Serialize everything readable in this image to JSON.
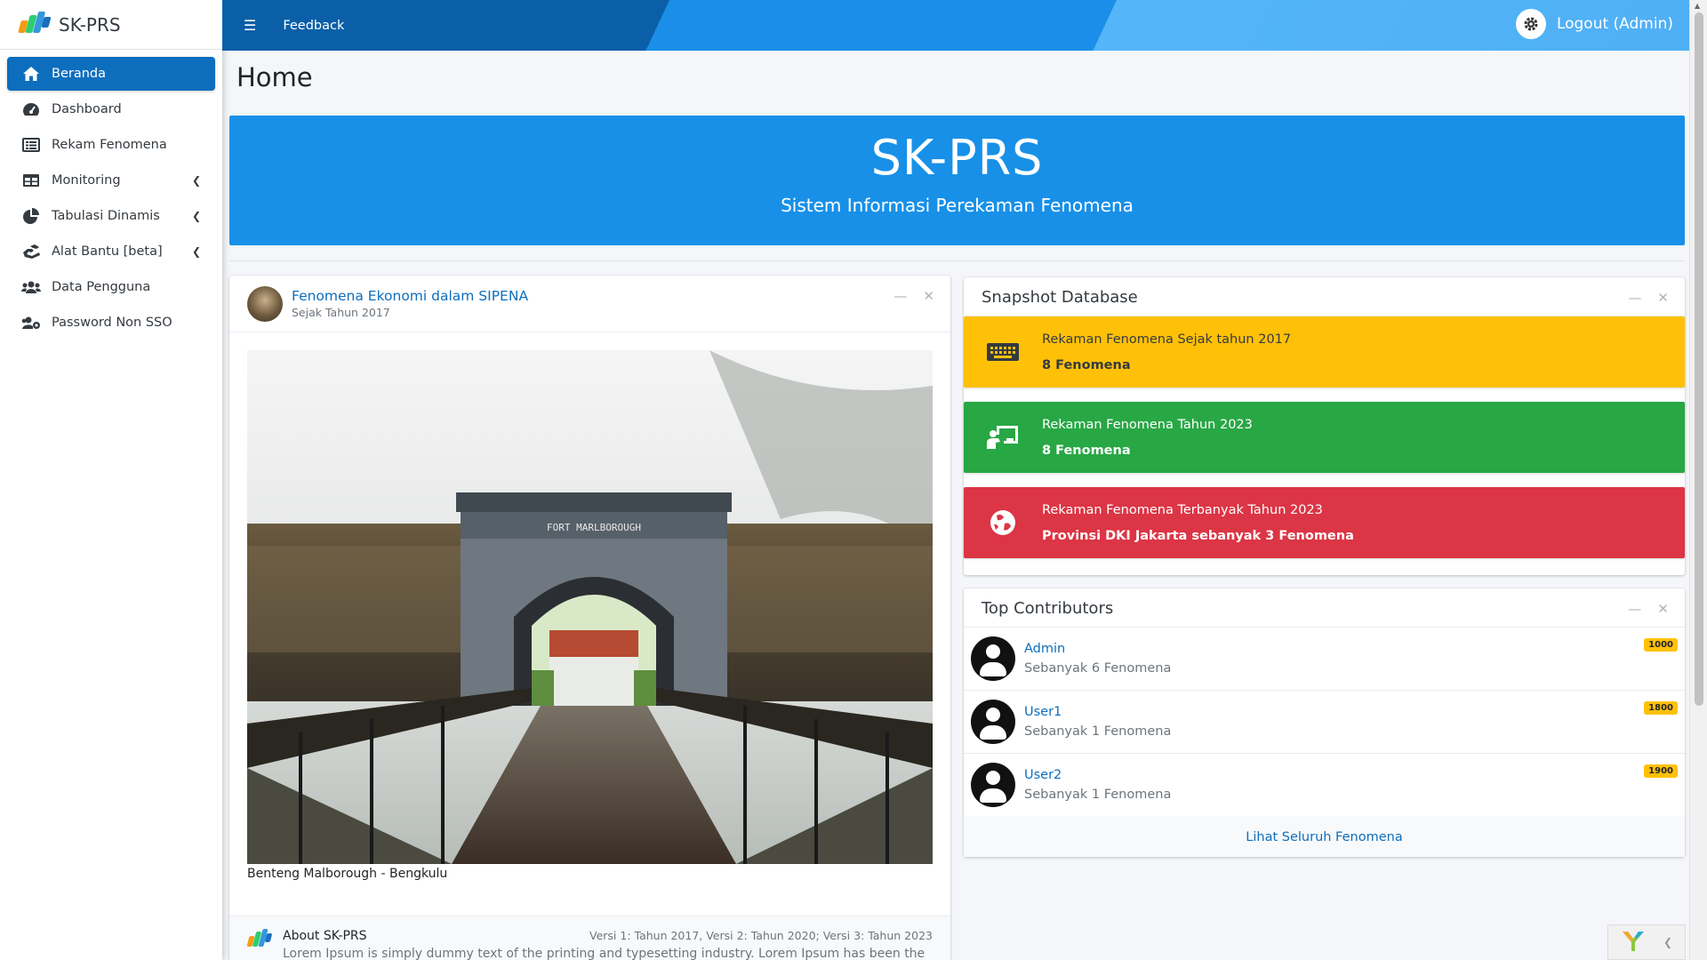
{
  "brand": {
    "name": "SK-PRS"
  },
  "sidebar": {
    "items": [
      {
        "label": "Beranda",
        "icon": "home-icon",
        "active": true
      },
      {
        "label": "Dashboard",
        "icon": "tachometer-icon"
      },
      {
        "label": "Rekam Fenomena",
        "icon": "list-alt-icon"
      },
      {
        "label": "Monitoring",
        "icon": "table-icon",
        "expandable": true
      },
      {
        "label": "Tabulasi Dinamis",
        "icon": "pie-chart-icon",
        "expandable": true
      },
      {
        "label": "Alat Bantu [beta]",
        "icon": "hands-helping-icon",
        "expandable": true
      },
      {
        "label": "Data Pengguna",
        "icon": "users-icon"
      },
      {
        "label": "Password Non SSO",
        "icon": "users-cog-icon"
      }
    ]
  },
  "topbar": {
    "feedback": "Feedback",
    "logout": "Logout (Admin)"
  },
  "page": {
    "title": "Home"
  },
  "hero": {
    "title": "SK-PRS",
    "subtitle": "Sistem Informasi Perekaman Fenomena"
  },
  "post": {
    "title": "Fenomena Ekonomi dalam SIPENA",
    "subtitle": "Sejak Tahun 2017",
    "image_text": "FORT MARLBOROUGH",
    "caption": "Benteng Malborough - Bengkulu",
    "about_title": "About SK-PRS",
    "about_version": "Versi 1: Tahun 2017, Versi 2: Tahun 2020; Versi 3: Tahun 2023",
    "about_text": "Lorem Ipsum is simply dummy text of the printing and typesetting industry. Lorem Ipsum has been the"
  },
  "snapshot": {
    "title": "Snapshot Database",
    "boxes": [
      {
        "label": "Rekaman Fenomena Sejak tahun 2017",
        "value": "8 Fenomena",
        "color": "#ffc107",
        "icon": "keyboard-icon"
      },
      {
        "label": "Rekaman Fenomena Tahun 2023",
        "value": "8 Fenomena",
        "color": "#28a745",
        "icon": "chalkboard-teacher-icon"
      },
      {
        "label": "Rekaman Fenomena Terbanyak Tahun 2023",
        "value": "Provinsi DKI Jakarta sebanyak 3 Fenomena",
        "color": "#dc3545",
        "icon": "globe-icon"
      }
    ]
  },
  "contributors": {
    "title": "Top Contributors",
    "items": [
      {
        "name": "Admin",
        "desc": "Sebanyak 6 Fenomena",
        "badge": "1000"
      },
      {
        "name": "User1",
        "desc": "Sebanyak 1 Fenomena",
        "badge": "1800"
      },
      {
        "name": "User2",
        "desc": "Sebanyak 1 Fenomena",
        "badge": "1900"
      }
    ],
    "footer_link": "Lihat Seluruh Fenomena"
  },
  "colors": {
    "primary": "#0d6ebd",
    "hero": "#1890e8",
    "warning": "#ffc107",
    "success": "#28a745",
    "danger": "#dc3545"
  }
}
